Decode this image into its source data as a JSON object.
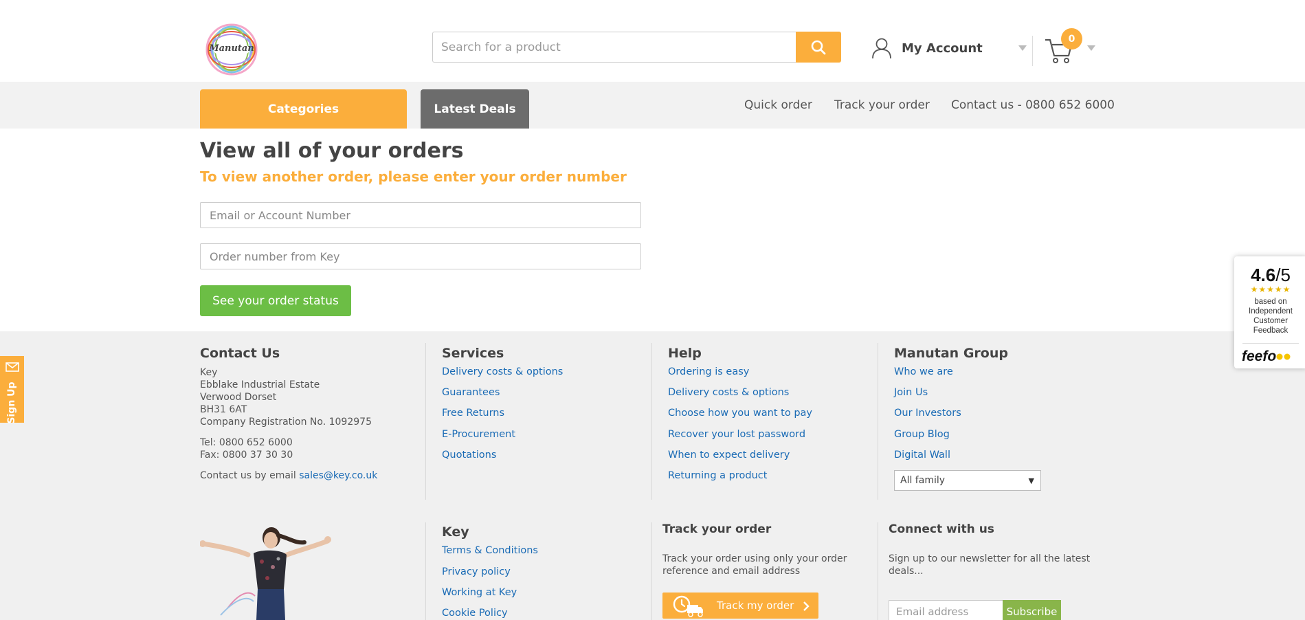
{
  "header": {
    "logo_text": "Manutan",
    "search_placeholder": "Search for a product",
    "account_label": "My Account",
    "cart_count": "0"
  },
  "nav": {
    "categories_label": "Categories",
    "deals_label": "Latest Deals",
    "links": [
      "Quick order",
      "Track your order",
      "Contact us - 0800 652 6000"
    ]
  },
  "main": {
    "title": "View all of your orders",
    "subtitle": "To view another order, please enter your order number",
    "email_placeholder": "Email or Account Number",
    "order_placeholder": "Order number from Key",
    "submit_label": "See your order status"
  },
  "footer": {
    "contact": {
      "heading": "Contact Us",
      "address": [
        "Key",
        "Ebblake Industrial Estate",
        "Verwood Dorset",
        "BH31 6AT",
        "Company Registration No. 1092975"
      ],
      "tel": "Tel: 0800 652 6000",
      "fax": "Fax: 0800 37 30 30",
      "email_prefix": "Contact us by email",
      "email": "sales@key.co.uk"
    },
    "services": {
      "heading": "Services",
      "links": [
        "Delivery costs & options",
        "Guarantees",
        "Free Returns",
        "E-Procurement",
        "Quotations"
      ]
    },
    "help": {
      "heading": "Help",
      "links": [
        "Ordering is easy",
        "Delivery costs & options",
        "Choose how you want to pay",
        "Recover your lost password",
        "When to expect delivery",
        "Returning a product"
      ]
    },
    "group": {
      "heading": "Manutan Group",
      "links": [
        "Who we are",
        "Join Us",
        "Our Investors",
        "Group Blog",
        "Digital Wall"
      ],
      "select_value": "All family"
    },
    "key": {
      "heading": "Key",
      "links": [
        "Terms & Conditions",
        "Privacy policy",
        "Working at Key",
        "Cookie Policy"
      ]
    },
    "track": {
      "heading": "Track your order",
      "text": [
        "Track your order using only your order",
        "reference and email address"
      ],
      "button_label": "Track my order"
    },
    "connect": {
      "heading": "Connect with us",
      "text": [
        "Sign up to our newsletter for all the latest",
        "deals..."
      ],
      "email_placeholder": "Email address",
      "subscribe_label": "Subscribe"
    }
  },
  "signup": {
    "label": "Sign Up"
  },
  "feefo": {
    "score": "4.6",
    "out_of": "/5",
    "stars": "★★★★★",
    "caption": [
      "based on",
      "Independent",
      "Customer",
      "Feedback"
    ],
    "logo": "feefo"
  },
  "colors": {
    "accent": "#fbae3c",
    "green": "#6cbe45",
    "link": "#1a6bb5",
    "dark_tab": "#6c6c6c"
  }
}
